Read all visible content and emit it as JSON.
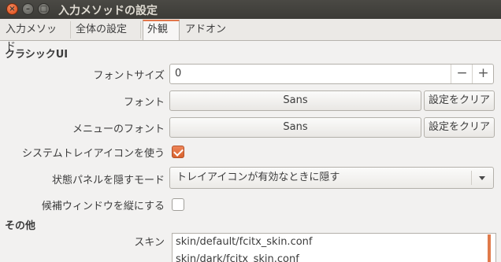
{
  "window": {
    "title": "入力メソッドの設定",
    "close_glyph": "×",
    "min_glyph": "–",
    "max_glyph": "□"
  },
  "tabs": [
    {
      "label": "入力メソッド"
    },
    {
      "label": "全体の設定"
    },
    {
      "label": "外観",
      "active": true
    },
    {
      "label": "アドオン"
    }
  ],
  "classic_ui": {
    "section_title": "クラシックUI",
    "font_size": {
      "label": "フォントサイズ",
      "value": "0",
      "minus": "−",
      "plus": "+"
    },
    "font": {
      "label": "フォント",
      "value": "Sans",
      "clear_label": "設定をクリア"
    },
    "menu_font": {
      "label": "メニューのフォント",
      "value": "Sans",
      "clear_label": "設定をクリア"
    },
    "system_tray": {
      "label": "システムトレイアイコンを使う",
      "checked": true
    },
    "hide_panel_mode": {
      "label": "状態パネルを隠すモード",
      "value": "トレイアイコンが有効なときに隠す"
    },
    "vertical_candidate": {
      "label": "候補ウィンドウを縦にする",
      "checked": false
    }
  },
  "other": {
    "section_title": "その他",
    "skin": {
      "label": "スキン",
      "items": [
        "skin/default/fcitx_skin.conf",
        "skin/dark/fcitx_skin.conf"
      ]
    }
  },
  "colors": {
    "accent": "#e2764b",
    "titlebar": "#3c3b37"
  }
}
